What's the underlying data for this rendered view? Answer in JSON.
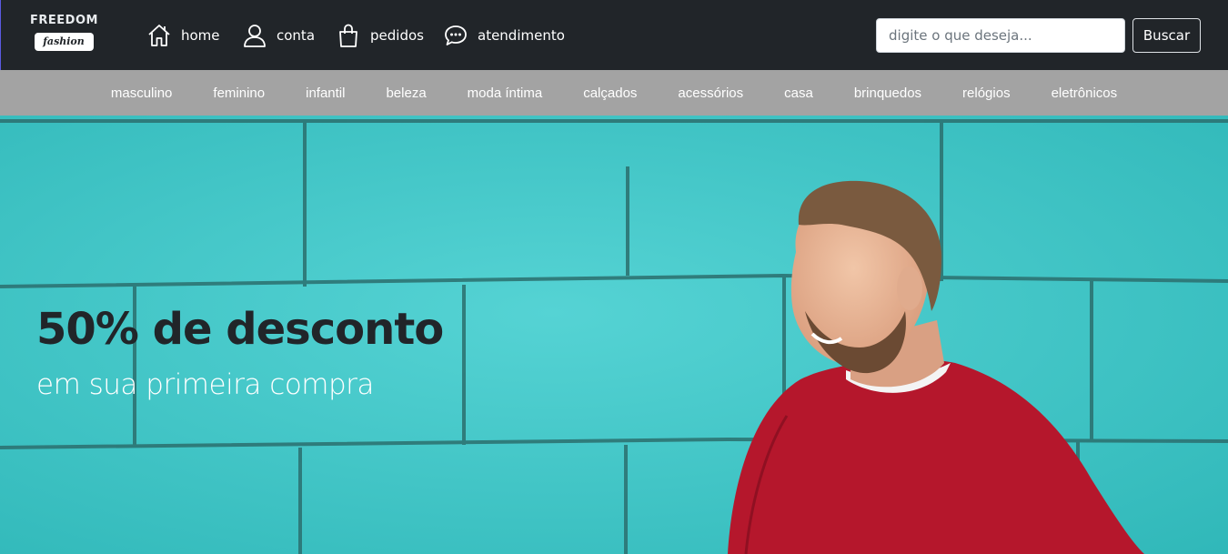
{
  "brand": {
    "name": "FREEDOM",
    "tagline": "fashion"
  },
  "nav": [
    {
      "label": "home",
      "icon": "house-icon"
    },
    {
      "label": "conta",
      "icon": "user-icon"
    },
    {
      "label": "pedidos",
      "icon": "shopping-bag-icon"
    },
    {
      "label": "atendimento",
      "icon": "chat-bubble-icon"
    }
  ],
  "search": {
    "placeholder": "digite o que deseja...",
    "value": "",
    "button_label": "Buscar"
  },
  "categories": [
    "masculino",
    "feminino",
    "infantil",
    "beleza",
    "moda íntima",
    "calçados",
    "acessórios",
    "casa",
    "brinquedos",
    "relógios",
    "eletrônicos"
  ],
  "hero": {
    "headline": "50% de desconto",
    "subheadline": "em sua primeira compra"
  },
  "colors": {
    "topbar": "#212529",
    "category_bar": "#a3a3a3",
    "hero_wall": "#3fc6c6",
    "headline": "#212529",
    "subheadline": "#ffffff",
    "sweater": "#b5172c"
  }
}
